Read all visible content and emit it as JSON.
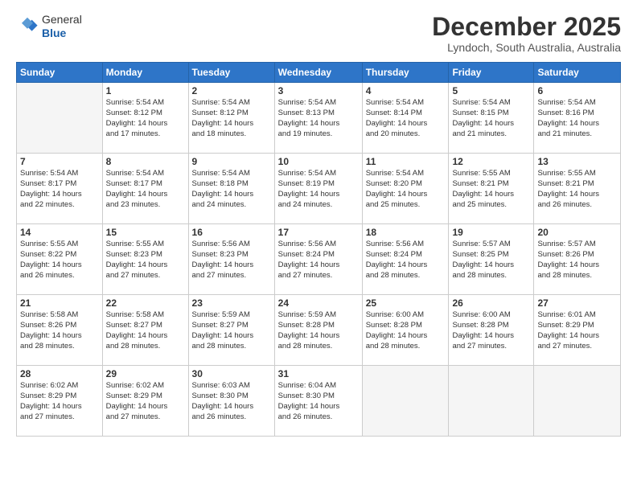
{
  "header": {
    "logo_line1": "General",
    "logo_line2": "Blue",
    "month_title": "December 2025",
    "subtitle": "Lyndoch, South Australia, Australia"
  },
  "weekdays": [
    "Sunday",
    "Monday",
    "Tuesday",
    "Wednesday",
    "Thursday",
    "Friday",
    "Saturday"
  ],
  "weeks": [
    [
      {
        "day": "",
        "info": ""
      },
      {
        "day": "1",
        "info": "Sunrise: 5:54 AM\nSunset: 8:12 PM\nDaylight: 14 hours\nand 17 minutes."
      },
      {
        "day": "2",
        "info": "Sunrise: 5:54 AM\nSunset: 8:12 PM\nDaylight: 14 hours\nand 18 minutes."
      },
      {
        "day": "3",
        "info": "Sunrise: 5:54 AM\nSunset: 8:13 PM\nDaylight: 14 hours\nand 19 minutes."
      },
      {
        "day": "4",
        "info": "Sunrise: 5:54 AM\nSunset: 8:14 PM\nDaylight: 14 hours\nand 20 minutes."
      },
      {
        "day": "5",
        "info": "Sunrise: 5:54 AM\nSunset: 8:15 PM\nDaylight: 14 hours\nand 21 minutes."
      },
      {
        "day": "6",
        "info": "Sunrise: 5:54 AM\nSunset: 8:16 PM\nDaylight: 14 hours\nand 21 minutes."
      }
    ],
    [
      {
        "day": "7",
        "info": "Sunrise: 5:54 AM\nSunset: 8:17 PM\nDaylight: 14 hours\nand 22 minutes."
      },
      {
        "day": "8",
        "info": "Sunrise: 5:54 AM\nSunset: 8:17 PM\nDaylight: 14 hours\nand 23 minutes."
      },
      {
        "day": "9",
        "info": "Sunrise: 5:54 AM\nSunset: 8:18 PM\nDaylight: 14 hours\nand 24 minutes."
      },
      {
        "day": "10",
        "info": "Sunrise: 5:54 AM\nSunset: 8:19 PM\nDaylight: 14 hours\nand 24 minutes."
      },
      {
        "day": "11",
        "info": "Sunrise: 5:54 AM\nSunset: 8:20 PM\nDaylight: 14 hours\nand 25 minutes."
      },
      {
        "day": "12",
        "info": "Sunrise: 5:55 AM\nSunset: 8:21 PM\nDaylight: 14 hours\nand 25 minutes."
      },
      {
        "day": "13",
        "info": "Sunrise: 5:55 AM\nSunset: 8:21 PM\nDaylight: 14 hours\nand 26 minutes."
      }
    ],
    [
      {
        "day": "14",
        "info": "Sunrise: 5:55 AM\nSunset: 8:22 PM\nDaylight: 14 hours\nand 26 minutes."
      },
      {
        "day": "15",
        "info": "Sunrise: 5:55 AM\nSunset: 8:23 PM\nDaylight: 14 hours\nand 27 minutes."
      },
      {
        "day": "16",
        "info": "Sunrise: 5:56 AM\nSunset: 8:23 PM\nDaylight: 14 hours\nand 27 minutes."
      },
      {
        "day": "17",
        "info": "Sunrise: 5:56 AM\nSunset: 8:24 PM\nDaylight: 14 hours\nand 27 minutes."
      },
      {
        "day": "18",
        "info": "Sunrise: 5:56 AM\nSunset: 8:24 PM\nDaylight: 14 hours\nand 28 minutes."
      },
      {
        "day": "19",
        "info": "Sunrise: 5:57 AM\nSunset: 8:25 PM\nDaylight: 14 hours\nand 28 minutes."
      },
      {
        "day": "20",
        "info": "Sunrise: 5:57 AM\nSunset: 8:26 PM\nDaylight: 14 hours\nand 28 minutes."
      }
    ],
    [
      {
        "day": "21",
        "info": "Sunrise: 5:58 AM\nSunset: 8:26 PM\nDaylight: 14 hours\nand 28 minutes."
      },
      {
        "day": "22",
        "info": "Sunrise: 5:58 AM\nSunset: 8:27 PM\nDaylight: 14 hours\nand 28 minutes."
      },
      {
        "day": "23",
        "info": "Sunrise: 5:59 AM\nSunset: 8:27 PM\nDaylight: 14 hours\nand 28 minutes."
      },
      {
        "day": "24",
        "info": "Sunrise: 5:59 AM\nSunset: 8:28 PM\nDaylight: 14 hours\nand 28 minutes."
      },
      {
        "day": "25",
        "info": "Sunrise: 6:00 AM\nSunset: 8:28 PM\nDaylight: 14 hours\nand 28 minutes."
      },
      {
        "day": "26",
        "info": "Sunrise: 6:00 AM\nSunset: 8:28 PM\nDaylight: 14 hours\nand 27 minutes."
      },
      {
        "day": "27",
        "info": "Sunrise: 6:01 AM\nSunset: 8:29 PM\nDaylight: 14 hours\nand 27 minutes."
      }
    ],
    [
      {
        "day": "28",
        "info": "Sunrise: 6:02 AM\nSunset: 8:29 PM\nDaylight: 14 hours\nand 27 minutes."
      },
      {
        "day": "29",
        "info": "Sunrise: 6:02 AM\nSunset: 8:29 PM\nDaylight: 14 hours\nand 27 minutes."
      },
      {
        "day": "30",
        "info": "Sunrise: 6:03 AM\nSunset: 8:30 PM\nDaylight: 14 hours\nand 26 minutes."
      },
      {
        "day": "31",
        "info": "Sunrise: 6:04 AM\nSunset: 8:30 PM\nDaylight: 14 hours\nand 26 minutes."
      },
      {
        "day": "",
        "info": ""
      },
      {
        "day": "",
        "info": ""
      },
      {
        "day": "",
        "info": ""
      }
    ]
  ]
}
